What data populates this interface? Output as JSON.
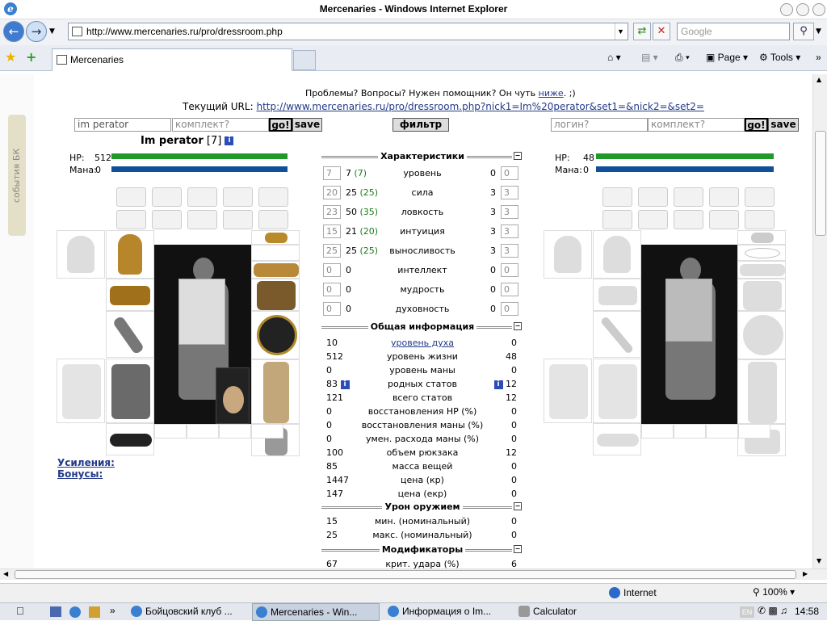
{
  "window": {
    "title": "Mercenaries - Windows Internet Explorer"
  },
  "nav": {
    "url": "http://www.mercenaries.ru/pro/dressroom.php",
    "search_placeholder": "Google"
  },
  "tabs": [
    {
      "label": "Mercenaries"
    }
  ],
  "toolbar": {
    "page_label": "Page",
    "tools_label": "Tools"
  },
  "page": {
    "help_text": "Проблемы? Вопросы? Нужен помощник? Он чуть",
    "help_link": "ниже",
    "help_tail": ". ;)",
    "current_url_label": "Текущий URL:",
    "current_url": "http://www.mercenaries.ru/pro/dressroom.php?nick1=Im%20perator&set1=&nick2=&set2=",
    "left": {
      "login_value": "im perator",
      "set_placeholder": "комплект?",
      "go_label": "go!",
      "save_label": "save"
    },
    "filter_label": "фильтр",
    "right": {
      "login_placeholder": "логин?",
      "set_placeholder": "комплект?",
      "go_label": "go!",
      "save_label": "save"
    },
    "side_tab": "события БК",
    "char1": {
      "name": "Im perator",
      "level": "[7]",
      "hp_label": "HP:",
      "hp": "512",
      "mana_label": "Мана:",
      "mana": "0"
    },
    "char2": {
      "hp_label": "HP:",
      "hp": "48",
      "mana_label": "Мана:",
      "mana": "0"
    },
    "links": {
      "boosts": "Усиления:",
      "bonuses": "Бонусы:"
    },
    "stats_title": "Характеристики",
    "stats": [
      {
        "box1": "7",
        "val": "7",
        "extra": "(7)",
        "label": "уровень",
        "right": "0",
        "box2": "0"
      },
      {
        "box1": "20",
        "val": "25",
        "extra": "(25)",
        "label": "сила",
        "right": "3",
        "box2": "3"
      },
      {
        "box1": "23",
        "val": "50",
        "extra": "(35)",
        "label": "ловкость",
        "right": "3",
        "box2": "3"
      },
      {
        "box1": "15",
        "val": "21",
        "extra": "(20)",
        "label": "интуиция",
        "right": "3",
        "box2": "3"
      },
      {
        "box1": "25",
        "val": "25",
        "extra": "(25)",
        "label": "выносливость",
        "right": "3",
        "box2": "3"
      },
      {
        "box1": "0",
        "val": "0",
        "extra": "",
        "label": "интеллект",
        "right": "0",
        "box2": "0"
      },
      {
        "box1": "0",
        "val": "0",
        "extra": "",
        "label": "мудрость",
        "right": "0",
        "box2": "0"
      },
      {
        "box1": "0",
        "val": "0",
        "extra": "",
        "label": "духовность",
        "right": "0",
        "box2": "0"
      }
    ],
    "info_title": "Общая информация",
    "info": [
      {
        "a": "10",
        "label": "уровень духа",
        "c": "0"
      },
      {
        "a": "512",
        "label": "уровень жизни",
        "c": "48"
      },
      {
        "a": "0",
        "label": "уровень маны",
        "c": "0"
      },
      {
        "a": "83",
        "label": "родных статов",
        "c": "12"
      },
      {
        "a": "121",
        "label": "всего статов",
        "c": "12"
      },
      {
        "a": "0",
        "label": "восстановления HP (%)",
        "c": "0"
      },
      {
        "a": "0",
        "label": "восстановления маны (%)",
        "c": "0"
      },
      {
        "a": "0",
        "label": "умен. расхода маны (%)",
        "c": "0"
      },
      {
        "a": "100",
        "label": "объем рюкзака",
        "c": "12"
      },
      {
        "a": "85",
        "label": "масса вещей",
        "c": "0"
      },
      {
        "a": "1447",
        "label": "цена (кр)",
        "c": "0"
      },
      {
        "a": "147",
        "label": "цена (екр)",
        "c": "0"
      }
    ],
    "weapon_title": "Урон оружием",
    "weapon": [
      {
        "a": "15",
        "label": "мин. (номинальный)",
        "c": "0"
      },
      {
        "a": "25",
        "label": "макс. (номинальный)",
        "c": "0"
      }
    ],
    "mods_title": "Модификаторы",
    "mods": [
      {
        "a": "67",
        "label": "крит. удара (%)",
        "c": "6"
      }
    ]
  },
  "status": {
    "zone": "Internet",
    "zoom": "100%"
  },
  "taskbar": {
    "tasks": [
      "Бойцовский клуб ...",
      "Mercenaries - Win...",
      "Информация о Im...",
      "Calculator"
    ],
    "lang": "EN",
    "time": "14:58"
  }
}
